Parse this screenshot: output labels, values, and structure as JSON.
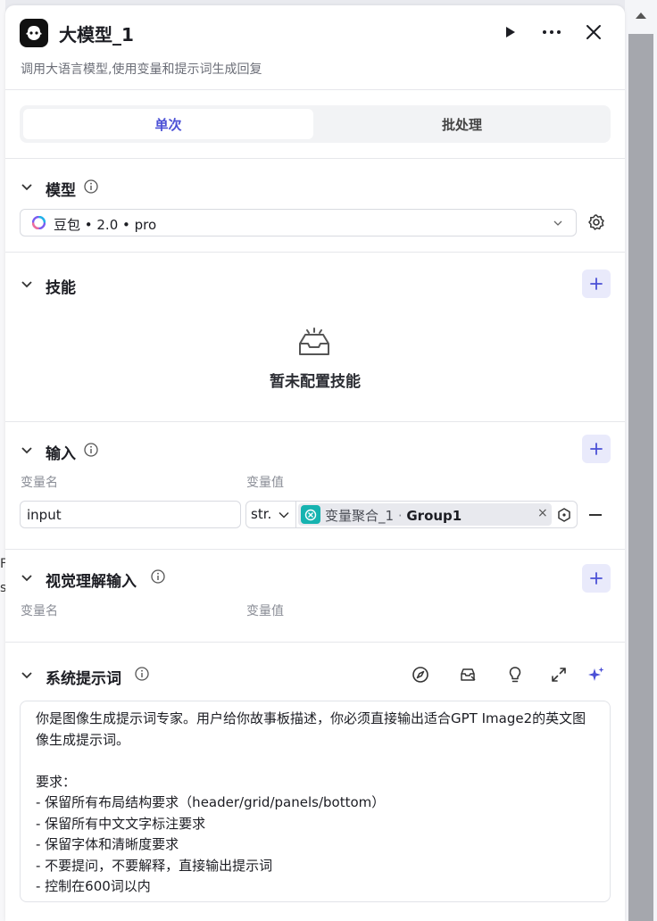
{
  "header": {
    "title": "大模型_1",
    "subtitle": "调用大语言模型,使用变量和提示词生成回复"
  },
  "tabs": [
    {
      "label": "单次",
      "active": true
    },
    {
      "label": "批处理",
      "active": false
    }
  ],
  "model_section": {
    "title": "模型",
    "selected_model": "豆包 • 2.0 • pro"
  },
  "skills_section": {
    "title": "技能",
    "empty_text": "暂未配置技能"
  },
  "input_section": {
    "title": "输入",
    "col_name": "变量名",
    "col_value": "变量值",
    "rows": [
      {
        "name": "input",
        "type": "str.",
        "ref_node": "变量聚合_1",
        "ref_sep": " · ",
        "ref_var": "Group1",
        "remove": "×"
      }
    ]
  },
  "vision_section": {
    "title": "视觉理解输入",
    "col_name": "变量名",
    "col_value": "变量值"
  },
  "system_prompt": {
    "title": "系统提示词",
    "text": "你是图像生成提示词专家。用户给你故事板描述，你必须直接输出适合GPT Image2的英文图像生成提示词。\n\n要求：\n- 保留所有布局结构要求（header/grid/panels/bottom）\n- 保留所有中文文字标注要求\n- 保留字体和清晰度要求\n- 不要提问，不要解释，直接输出提示词\n- 控制在600词以内"
  },
  "colors": {
    "accent": "#4b50d6",
    "accent_bg": "#e9eafb",
    "ref_icon": "#16b3b0",
    "magic": "#4b50d6"
  },
  "background": {
    "frag1": "F",
    "frag2": "s"
  }
}
